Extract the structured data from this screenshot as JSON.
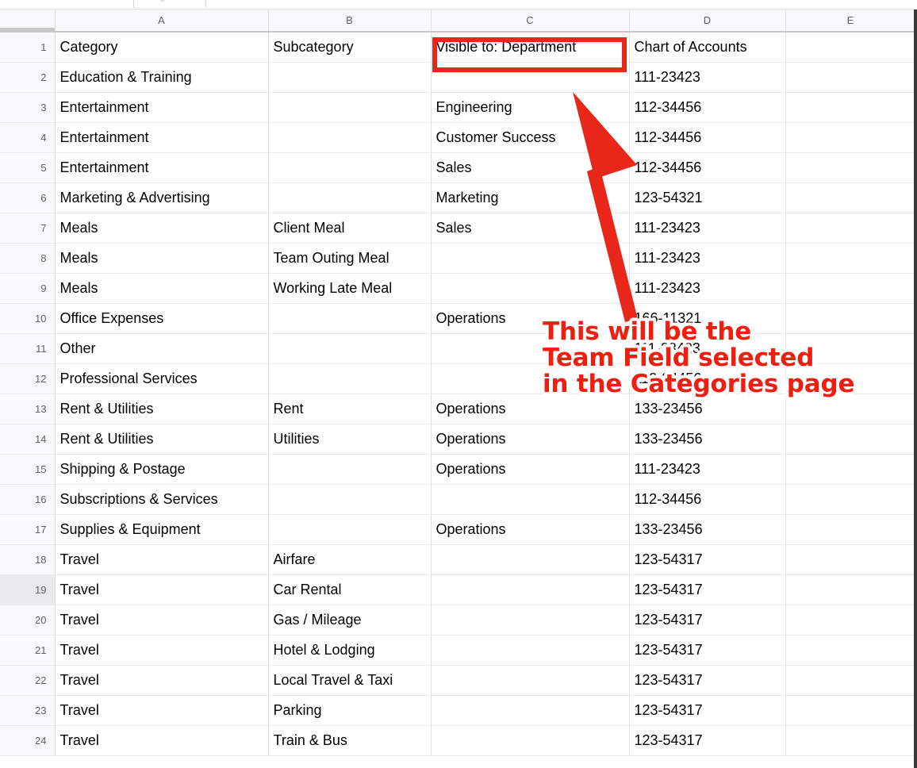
{
  "toolbar": {
    "ghost_glyph": "J"
  },
  "sheet": {
    "column_headers": [
      "A",
      "B",
      "C",
      "D",
      "E"
    ],
    "row_numbers": [
      "1",
      "2",
      "3",
      "4",
      "5",
      "6",
      "7",
      "8",
      "9",
      "10",
      "11",
      "12",
      "13",
      "14",
      "15",
      "16",
      "17",
      "18",
      "19",
      "20",
      "21",
      "22",
      "23",
      "24"
    ],
    "hovered_row": "19",
    "rows": [
      {
        "n": "1",
        "a": "Category",
        "b": "Subcategory",
        "c": "Visible to: Department",
        "d": "Chart of Accounts",
        "e": ""
      },
      {
        "n": "2",
        "a": "Education & Training",
        "b": "",
        "c": "",
        "d": "111-23423",
        "e": ""
      },
      {
        "n": "3",
        "a": "Entertainment",
        "b": "",
        "c": "Engineering",
        "d": "112-34456",
        "e": ""
      },
      {
        "n": "4",
        "a": "Entertainment",
        "b": "",
        "c": "Customer Success",
        "d": "112-34456",
        "e": ""
      },
      {
        "n": "5",
        "a": "Entertainment",
        "b": "",
        "c": "Sales",
        "d": "112-34456",
        "e": ""
      },
      {
        "n": "6",
        "a": "Marketing & Advertising",
        "b": "",
        "c": "Marketing",
        "d": "123-54321",
        "e": ""
      },
      {
        "n": "7",
        "a": "Meals",
        "b": "Client Meal",
        "c": "Sales",
        "d": "111-23423",
        "e": ""
      },
      {
        "n": "8",
        "a": "Meals",
        "b": "Team Outing Meal",
        "c": "",
        "d": "111-23423",
        "e": ""
      },
      {
        "n": "9",
        "a": "Meals",
        "b": "Working Late Meal",
        "c": "",
        "d": "111-23423",
        "e": ""
      },
      {
        "n": "10",
        "a": "Office Expenses",
        "b": "",
        "c": "Operations",
        "d": "166-11321",
        "e": ""
      },
      {
        "n": "11",
        "a": "Other",
        "b": "",
        "c": "",
        "d": "111-23423",
        "e": ""
      },
      {
        "n": "12",
        "a": "Professional Services",
        "b": "",
        "c": "",
        "d": "112-34456",
        "e": ""
      },
      {
        "n": "13",
        "a": "Rent & Utilities",
        "b": "Rent",
        "c": "Operations",
        "d": "133-23456",
        "e": ""
      },
      {
        "n": "14",
        "a": "Rent & Utilities",
        "b": "Utilities",
        "c": "Operations",
        "d": "133-23456",
        "e": ""
      },
      {
        "n": "15",
        "a": "Shipping & Postage",
        "b": "",
        "c": "Operations",
        "d": "111-23423",
        "e": ""
      },
      {
        "n": "16",
        "a": "Subscriptions & Services",
        "b": "",
        "c": "",
        "d": "112-34456",
        "e": ""
      },
      {
        "n": "17",
        "a": "Supplies & Equipment",
        "b": "",
        "c": "Operations",
        "d": "133-23456",
        "e": ""
      },
      {
        "n": "18",
        "a": "Travel",
        "b": "Airfare",
        "c": "",
        "d": "123-54317",
        "e": ""
      },
      {
        "n": "19",
        "a": "Travel",
        "b": "Car Rental",
        "c": "",
        "d": "123-54317",
        "e": ""
      },
      {
        "n": "20",
        "a": "Travel",
        "b": "Gas / Mileage",
        "c": "",
        "d": "123-54317",
        "e": ""
      },
      {
        "n": "21",
        "a": "Travel",
        "b": "Hotel & Lodging",
        "c": "",
        "d": "123-54317",
        "e": ""
      },
      {
        "n": "22",
        "a": "Travel",
        "b": "Local Travel & Taxi",
        "c": "",
        "d": "123-54317",
        "e": ""
      },
      {
        "n": "23",
        "a": "Travel",
        "b": "Parking",
        "c": "",
        "d": "123-54317",
        "e": ""
      },
      {
        "n": "24",
        "a": "Travel",
        "b": "Train & Bus",
        "c": "",
        "d": "123-54317",
        "e": ""
      }
    ]
  },
  "annotation": {
    "highlight_cell": "C1",
    "callout_line1": "This will be the",
    "callout_line2": "Team Field selected",
    "callout_line3": "in the Categories page",
    "accent_color": "#e8261a",
    "text_color": "#f01e0f"
  }
}
